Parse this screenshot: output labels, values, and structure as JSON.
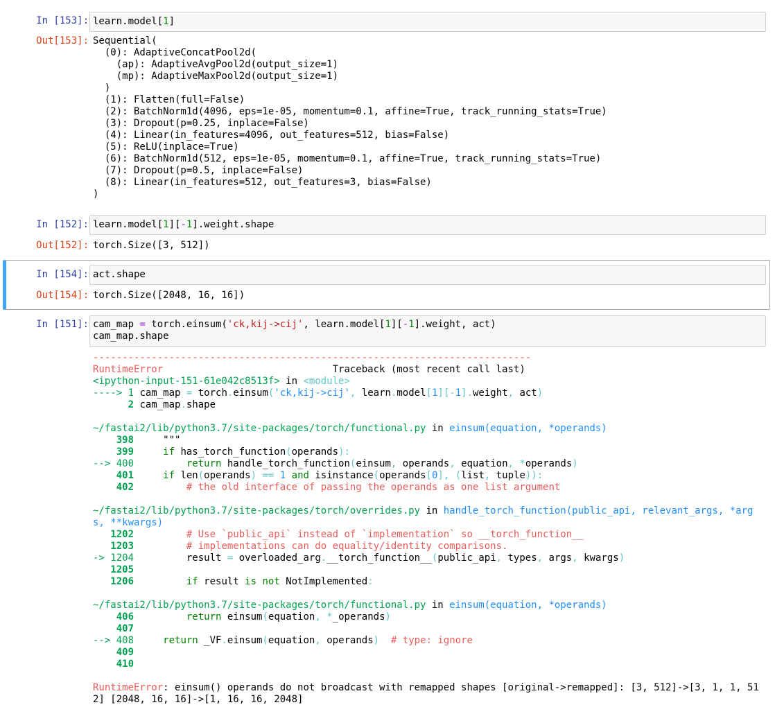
{
  "cells": [
    {
      "in_prompt": "In [153]:",
      "input": "learn.model[1]",
      "out_prompt": "Out[153]:",
      "output_lines": [
        "Sequential(",
        "  (0): AdaptiveConcatPool2d(",
        "    (ap): AdaptiveAvgPool2d(output_size=1)",
        "    (mp): AdaptiveMaxPool2d(output_size=1)",
        "  )",
        "  (1): Flatten(full=False)",
        "  (2): BatchNorm1d(4096, eps=1e-05, momentum=0.1, affine=True, track_running_stats=True)",
        "  (3): Dropout(p=0.25, inplace=False)",
        "  (4): Linear(in_features=4096, out_features=512, bias=False)",
        "  (5): ReLU(inplace=True)",
        "  (6): BatchNorm1d(512, eps=1e-05, momentum=0.1, affine=True, track_running_stats=True)",
        "  (7): Dropout(p=0.5, inplace=False)",
        "  (8): Linear(in_features=512, out_features=3, bias=False)",
        ")"
      ]
    },
    {
      "in_prompt": "In [152]:",
      "input": "learn.model[1][-1].weight.shape",
      "out_prompt": "Out[152]:",
      "output_lines": [
        "torch.Size([3, 512])"
      ]
    },
    {
      "in_prompt": "In [154]:",
      "input": "act.shape",
      "out_prompt": "Out[154]:",
      "output_lines": [
        "torch.Size([2048, 16, 16])"
      ]
    },
    {
      "in_prompt": "In [151]:",
      "input_lines": [
        "cam_map = torch.einsum('ck,kij->cij', learn.model[1][-1].weight, act)",
        "cam_map.shape"
      ]
    }
  ],
  "traceback": {
    "separator": "---------------------------------------------------------------------------",
    "error_name": "RuntimeError",
    "header_right": "Traceback (most recent call last)",
    "frame0_file": "<ipython-input-151-61e042c8513f>",
    "frame0_in": " in ",
    "frame0_module": "<module>",
    "frame0_line1_arrow": "----> 1 ",
    "frame0_line1": "cam_map = torch.einsum('ck,kij->cij', learn.model[1][-1].weight, act)",
    "frame0_line2_no": "      2 ",
    "frame0_line2": "cam_map.shape",
    "frame1_file": "~/fastai2/lib/python3.7/site-packages/torch/functional.py",
    "frame1_func": "einsum(equation, *operands)",
    "frame1_lines": [
      {
        "no": "    398 ",
        "code": "    \"\"\""
      },
      {
        "no": "    399 ",
        "code": "    if has_torch_function(operands):"
      },
      {
        "no": "--> 400 ",
        "code": "        return handle_torch_function(einsum, operands, equation, *operands)"
      },
      {
        "no": "    401 ",
        "code": "    if len(operands) == 1 and isinstance(operands[0], (list, tuple)):"
      },
      {
        "no": "    402 ",
        "code": "        # the old interface of passing the operands as one list argument"
      }
    ],
    "frame2_file": "~/fastai2/lib/python3.7/site-packages/torch/overrides.py",
    "frame2_func": "handle_torch_function(public_api, relevant_args, *arg",
    "frame2_func_cont": "s, **kwargs)",
    "frame2_lines": [
      {
        "no": "   1202 ",
        "code": "        # Use `public_api` instead of `implementation` so __torch_function__"
      },
      {
        "no": "   1203 ",
        "code": "        # implementations can do equality/identity comparisons."
      },
      {
        "no": "-> 1204 ",
        "code": "        result = overloaded_arg.__torch_function__(public_api, types, args, kwargs)"
      },
      {
        "no": "   1205 ",
        "code": ""
      },
      {
        "no": "   1206 ",
        "code": "        if result is not NotImplemented:"
      }
    ],
    "frame3_file": "~/fastai2/lib/python3.7/site-packages/torch/functional.py",
    "frame3_func": "einsum(equation, *operands)",
    "frame3_lines": [
      {
        "no": "    406 ",
        "code": "        return einsum(equation, *_operands)"
      },
      {
        "no": "    407 ",
        "code": ""
      },
      {
        "no": "--> 408 ",
        "code": "    return _VF.einsum(equation, operands)  # type: ignore"
      },
      {
        "no": "    409 ",
        "code": ""
      },
      {
        "no": "    410 ",
        "code": ""
      }
    ],
    "final_error_name": "RuntimeError",
    "final_error_msg": ": einsum() operands do not broadcast with remapped shapes [original->remapped]: [3, 512]->[3, 1, 1, 51",
    "final_error_msg_cont": "2] [2048, 16, 16]->[1, 16, 16, 2048]"
  }
}
